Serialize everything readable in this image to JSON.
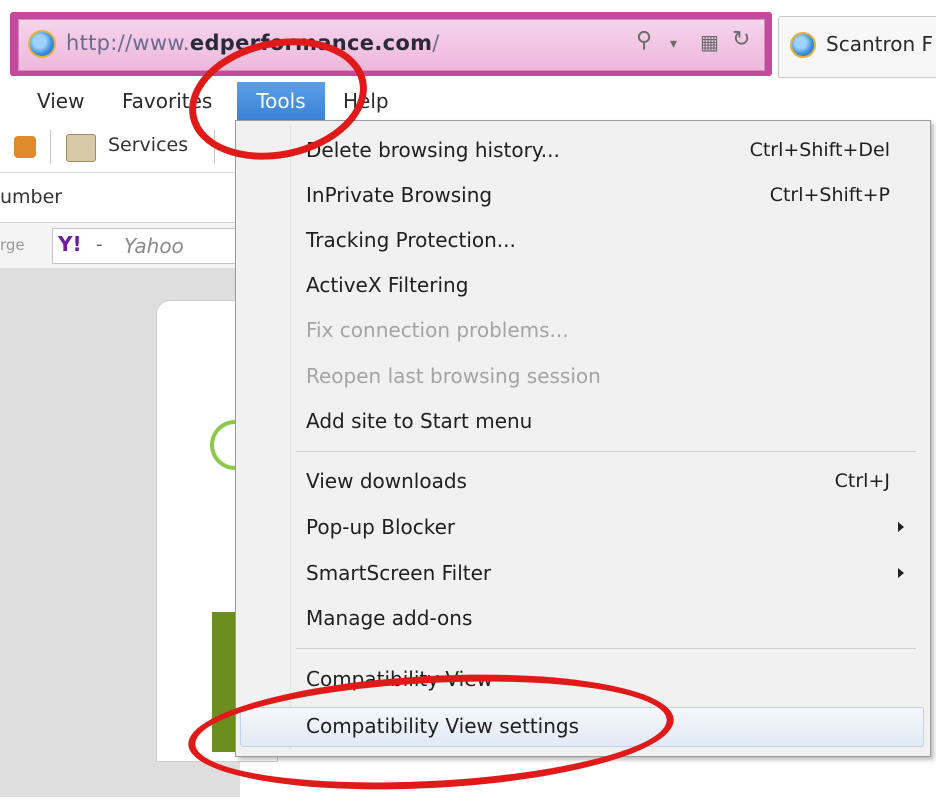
{
  "address_bar": {
    "url_prefix": "http://www.",
    "url_bold": "edperformance.com",
    "url_suffix": "/",
    "search_icon": "magnifier-icon",
    "dropdown_icon": "chevron-down-icon",
    "compat_icon": "compatibility-view-icon",
    "refresh_icon": "refresh-icon"
  },
  "tab": {
    "title": "Scantron F"
  },
  "menubar": {
    "view": "View",
    "favorites": "Favorites",
    "tools": "Tools",
    "help": "Help"
  },
  "toolbar": {
    "services": "Services",
    "row2_text": "umber",
    "row3_prefix": "rge",
    "yahoo_logo": "Y!",
    "yahoo_dash": "-",
    "yahoo_label": "Yahoo"
  },
  "tools_menu": {
    "items": [
      {
        "label": "Delete browsing history...",
        "shortcut": "Ctrl+Shift+Del",
        "disabled": false
      },
      {
        "label": "InPrivate Browsing",
        "shortcut": "Ctrl+Shift+P",
        "disabled": false
      },
      {
        "label": "Tracking Protection...",
        "shortcut": "",
        "disabled": false
      },
      {
        "label": "ActiveX Filtering",
        "shortcut": "",
        "disabled": false
      },
      {
        "label": "Fix connection problems...",
        "shortcut": "",
        "disabled": true
      },
      {
        "label": "Reopen last browsing session",
        "shortcut": "",
        "disabled": true
      },
      {
        "label": "Add site to Start menu",
        "shortcut": "",
        "disabled": false
      },
      {
        "label": "View downloads",
        "shortcut": "Ctrl+J",
        "disabled": false
      },
      {
        "label": "Pop-up Blocker",
        "shortcut": "",
        "disabled": false,
        "submenu": true
      },
      {
        "label": "SmartScreen Filter",
        "shortcut": "",
        "disabled": false,
        "submenu": true
      },
      {
        "label": "Manage add-ons",
        "shortcut": "",
        "disabled": false
      },
      {
        "label": "Compatibility View",
        "shortcut": "",
        "disabled": false
      },
      {
        "label": "Compatibility View settings",
        "shortcut": "",
        "disabled": false,
        "highlighted": true
      }
    ]
  },
  "colors": {
    "annotation_red": "#e01919",
    "address_bar_pink": "#c64a9b",
    "menu_active_blue": "#3c82d6"
  }
}
